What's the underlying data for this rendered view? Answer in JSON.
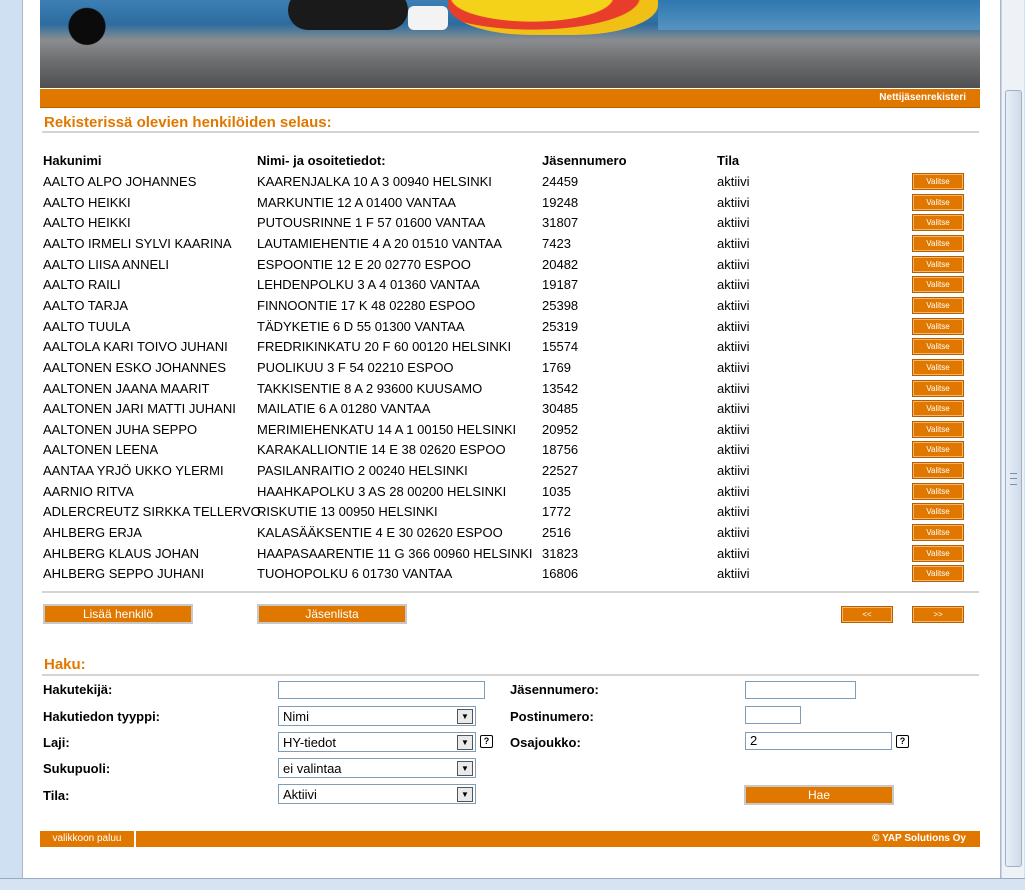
{
  "header": {
    "link": "Nettijäsenrekisteri"
  },
  "browse": {
    "title": "Rekisterissä olevien henkilöiden selaus:",
    "columns": [
      "Hakunimi",
      "Nimi- ja osoitetiedot:",
      "Jäsennumero",
      "Tila"
    ],
    "select_label": "Valitse",
    "rows": [
      {
        "name": "AALTO ALPO JOHANNES",
        "address": "KAARENJALKA 10 A 3 00940 HELSINKI",
        "number": "24459",
        "status": "aktiivi"
      },
      {
        "name": "AALTO HEIKKI",
        "address": "MARKUNTIE 12 A 01400 VANTAA",
        "number": "19248",
        "status": "aktiivi"
      },
      {
        "name": "AALTO HEIKKI",
        "address": "PUTOUSRINNE 1 F 57 01600 VANTAA",
        "number": "31807",
        "status": "aktiivi"
      },
      {
        "name": "AALTO IRMELI SYLVI KAARINA",
        "address": "LAUTAMIEHENTIE 4 A 20 01510 VANTAA",
        "number": "7423",
        "status": "aktiivi"
      },
      {
        "name": "AALTO LIISA ANNELI",
        "address": "ESPOONTIE 12 E 20 02770 ESPOO",
        "number": "20482",
        "status": "aktiivi"
      },
      {
        "name": "AALTO RAILI",
        "address": "LEHDENPOLKU 3 A 4 01360 VANTAA",
        "number": "19187",
        "status": "aktiivi"
      },
      {
        "name": "AALTO TARJA",
        "address": "FINNOONTIE 17 K 48 02280 ESPOO",
        "number": "25398",
        "status": "aktiivi"
      },
      {
        "name": "AALTO TUULA",
        "address": "TÄDYKETIE 6 D 55 01300 VANTAA",
        "number": "25319",
        "status": "aktiivi"
      },
      {
        "name": "AALTOLA KARI TOIVO JUHANI",
        "address": "FREDRIKINKATU 20 F 60 00120 HELSINKI",
        "number": "15574",
        "status": "aktiivi"
      },
      {
        "name": "AALTONEN ESKO JOHANNES",
        "address": "PUOLIKUU 3 F 54 02210 ESPOO",
        "number": "1769",
        "status": "aktiivi"
      },
      {
        "name": "AALTONEN JAANA MAARIT",
        "address": "TAKKISENTIE 8 A 2 93600 KUUSAMO",
        "number": "13542",
        "status": "aktiivi"
      },
      {
        "name": "AALTONEN JARI MATTI JUHANI",
        "address": "MAILATIE 6 A 01280 VANTAA",
        "number": "30485",
        "status": "aktiivi"
      },
      {
        "name": "AALTONEN JUHA SEPPO",
        "address": "MERIMIEHENKATU 14 A 1 00150 HELSINKI",
        "number": "20952",
        "status": "aktiivi"
      },
      {
        "name": "AALTONEN LEENA",
        "address": "KARAKALLIONTIE 14 E 38 02620 ESPOO",
        "number": "18756",
        "status": "aktiivi"
      },
      {
        "name": "AANTAA YRJÖ UKKO YLERMI",
        "address": "PASILANRAITIO 2 00240 HELSINKI",
        "number": "22527",
        "status": "aktiivi"
      },
      {
        "name": "AARNIO RITVA",
        "address": "HAAHKAPOLKU 3 AS 28 00200 HELSINKI",
        "number": "1035",
        "status": "aktiivi"
      },
      {
        "name": "ADLERCREUTZ SIRKKA TELLERVO",
        "address": "RISKUTIE 13 00950 HELSINKI",
        "number": "1772",
        "status": "aktiivi"
      },
      {
        "name": "AHLBERG ERJA",
        "address": "KALASÄÄKSENTIE 4 E 30 02620 ESPOO",
        "number": "2516",
        "status": "aktiivi"
      },
      {
        "name": "AHLBERG KLAUS JOHAN",
        "address": "HAAPASAARENTIE 11 G 366 00960 HELSINKI",
        "number": "31823",
        "status": "aktiivi"
      },
      {
        "name": "AHLBERG SEPPO JUHANI",
        "address": "TUOHOPOLKU 6 01730 VANTAA",
        "number": "16806",
        "status": "aktiivi"
      }
    ],
    "add_person": "Lisää henkilö",
    "member_list": "Jäsenlista",
    "prev": "<<",
    "next": ">>"
  },
  "search": {
    "title": "Haku:",
    "search_term_label": "Hakutekijä:",
    "search_term_value": "",
    "search_type_label": "Hakutiedon tyyppi:",
    "search_type_value": "Nimi",
    "kind_label": "Laji:",
    "kind_value": "HY-tiedot",
    "gender_label": "Sukupuoli:",
    "gender_value": "ei valintaa",
    "status_label": "Tila:",
    "status_value": "Aktiivi",
    "member_number_label": "Jäsennumero:",
    "member_number_value": "",
    "postal_code_label": "Postinumero:",
    "postal_code_value": "",
    "subset_label": "Osajoukko:",
    "subset_value": "2",
    "help_glyph": "?",
    "search_button": "Hae"
  },
  "footer": {
    "back": "valikkoon paluu",
    "copyright": "© YAP Solutions Oy"
  }
}
